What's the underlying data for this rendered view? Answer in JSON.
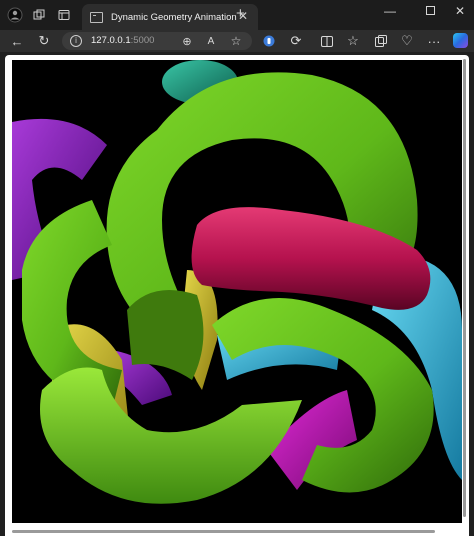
{
  "browser": {
    "tab": {
      "title": "Dynamic Geometry Animation"
    },
    "address": {
      "host": "127.0.0.1",
      "port": ":5000"
    },
    "icons": {
      "tab_strip": [
        "profile-icon",
        "workspaces-icon",
        "tab-actions-icon"
      ],
      "toolbar": [
        "back-icon",
        "refresh-icon",
        "info-icon",
        "zoom-icon",
        "read-aloud-icon",
        "favorite-star-icon",
        "extension-icon",
        "extension-puzzle-icon",
        "split-screen-icon",
        "favorites-icon",
        "collections-icon",
        "browser-essentials-icon",
        "more-icon",
        "copilot-icon"
      ],
      "window": [
        "minimize-icon",
        "maximize-icon",
        "close-icon"
      ]
    }
  },
  "canvas": {
    "background": "#000000",
    "tube_colors": [
      "#6ecc1e",
      "#4a8a12",
      "#cc1a5a",
      "#2ab4dd",
      "#8a1fc4",
      "#c4b82a",
      "#1a9a80",
      "#d21acb"
    ]
  }
}
